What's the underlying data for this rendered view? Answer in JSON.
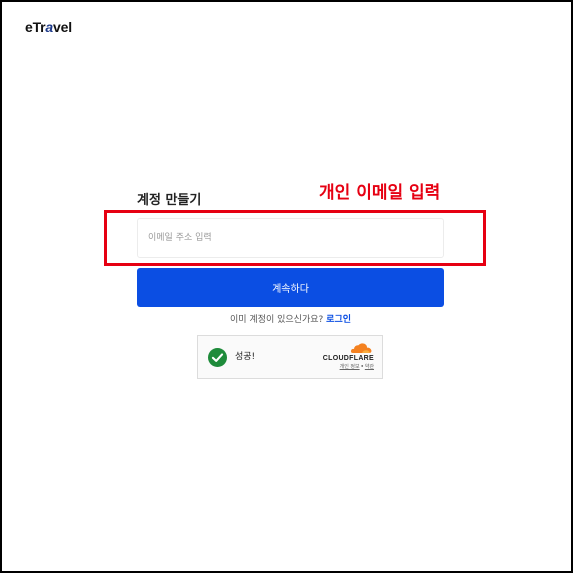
{
  "header": {
    "logo_prefix": "eTr",
    "logo_accent": "a",
    "logo_suffix": "vel"
  },
  "form": {
    "title": "계정 만들기",
    "email_placeholder": "이메일 주소 입력",
    "email_value": "",
    "continue_label": "계속하다",
    "login_prompt": "이미 계정이 있으신가요?",
    "login_link": "로그인"
  },
  "annotation": {
    "text": "개인 이메일 입력",
    "color": "#e60012"
  },
  "captcha": {
    "status": "성공!",
    "provider": "CLOUDFLARE",
    "privacy_link": "개인 정보",
    "separator": "•",
    "terms_link": "약관"
  },
  "colors": {
    "primary": "#0b4ee3",
    "highlight": "#e60012",
    "success": "#1e8b3a",
    "cloudflare": "#f48120"
  },
  "icons": {
    "captcha_check": "check-circle-icon",
    "cloudflare_logo": "cloud-icon"
  }
}
